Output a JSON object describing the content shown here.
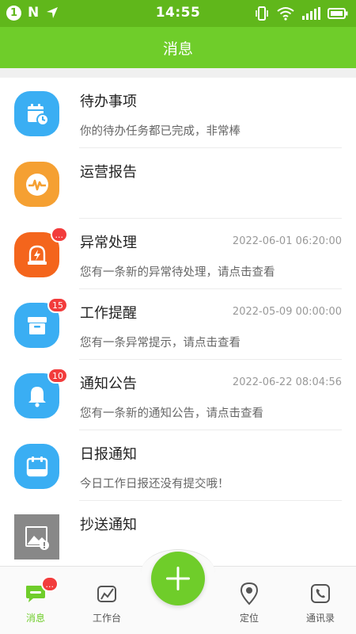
{
  "status_bar": {
    "notification_count": "1",
    "n_icon": "N",
    "time": "14:55"
  },
  "header": {
    "title": "消息"
  },
  "messages": [
    {
      "title": "待办事项",
      "time": "",
      "subtitle": "你的待办任务都已完成，非常棒",
      "icon": "calendar-clock-icon",
      "color": "#3aaef3",
      "badge": ""
    },
    {
      "title": "运营报告",
      "time": "",
      "subtitle": "",
      "icon": "pulse-icon",
      "color": "#f5a032",
      "badge": ""
    },
    {
      "title": "异常处理",
      "time": "2022-06-01 06:20:00",
      "subtitle": "您有一条新的异常待处理，请点击查看",
      "icon": "warning-light-icon",
      "color": "#f4651c",
      "badge": "..."
    },
    {
      "title": "工作提醒",
      "time": "2022-05-09 00:00:00",
      "subtitle": "您有一条异常提示，请点击查看",
      "icon": "archive-box-icon",
      "color": "#3aaef3",
      "badge": "15"
    },
    {
      "title": "通知公告",
      "time": "2022-06-22 08:04:56",
      "subtitle": "您有一条新的通知公告，请点击查看",
      "icon": "bell-icon",
      "color": "#3aaef3",
      "badge": "10"
    },
    {
      "title": "日报通知",
      "time": "",
      "subtitle": "今日工作日报还没有提交哦！",
      "icon": "daily-report-icon",
      "color": "#3aaef3",
      "badge": ""
    },
    {
      "title": "抄送通知",
      "time": "",
      "subtitle": "",
      "icon": "broken-image-icon",
      "color": "#888888",
      "badge": ""
    }
  ],
  "bottom_nav": {
    "items": [
      {
        "label": "消息",
        "badge": "...",
        "active": true
      },
      {
        "label": "工作台"
      },
      {
        "label": "定位"
      },
      {
        "label": "通讯录"
      }
    ]
  },
  "colors": {
    "brand": "#6fcd2a",
    "status_bar": "#60b71b",
    "badge": "#f23c3c"
  }
}
